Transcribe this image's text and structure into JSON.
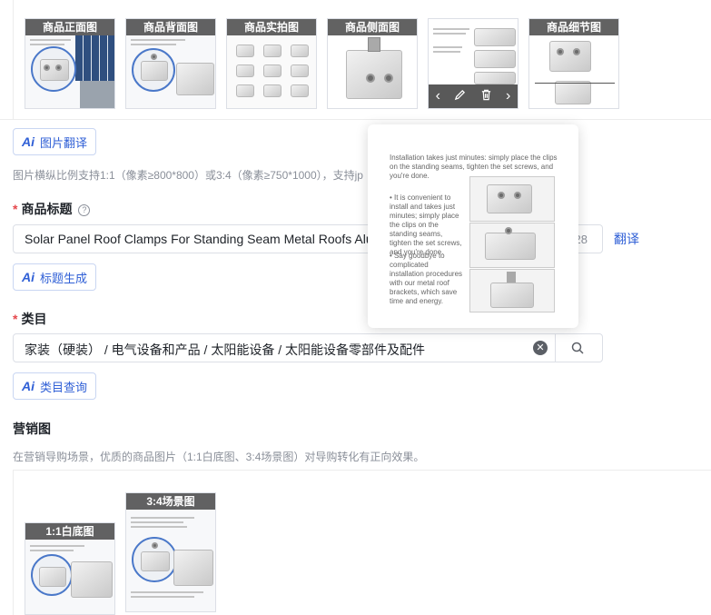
{
  "product_images": [
    {
      "label": "商品正面图"
    },
    {
      "label": "商品背面图"
    },
    {
      "label": "商品实拍图"
    },
    {
      "label": "商品侧面图"
    },
    {
      "label": ""
    },
    {
      "label": "商品细节图"
    }
  ],
  "hover_controls": {
    "prev": "‹",
    "next": "›"
  },
  "image_translate_label": "图片翻译",
  "image_hint": "图片横纵比例支持1:1（像素≥800*800）或3:4（像素≥750*1000），支持jp",
  "title_section": {
    "label": "商品标题",
    "required_mark": "*",
    "value": "Solar Panel Roof Clamps For Standing Seam Metal Roofs Alum",
    "counter": "28",
    "translate_link": "翻译",
    "generate_label": "标题生成"
  },
  "category_section": {
    "label": "类目",
    "required_mark": "*",
    "value": "家装（硬装） / 电气设备和产品 / 太阳能设备 / 太阳能设备零部件及配件",
    "clear_symbol": "✕",
    "query_label": "类目查询"
  },
  "marketing_section": {
    "label": "营销图",
    "hint": "在营销导购场景，优质的商品图片（1:1白底图、3:4场景图）对导购转化有正向效果。",
    "images": [
      {
        "label": "1:1白底图"
      },
      {
        "label": "3:4场景图"
      }
    ]
  },
  "popup": {
    "intro": "Installation takes just minutes: simply place the clips on the standing seams, tighten the set screws, and you're done.",
    "bullets": [
      "It is convenient to install and takes just minutes; simply place the clips on the standing seams, tighten the set screws, and you're done.",
      "Say goodbye to complicated installation procedures with our metal roof brackets, which save time and energy."
    ]
  },
  "ai_mark": "Ai",
  "colors": {
    "accent": "#2f5fd6",
    "required": "#e5484d",
    "hint": "#8a8f99"
  }
}
